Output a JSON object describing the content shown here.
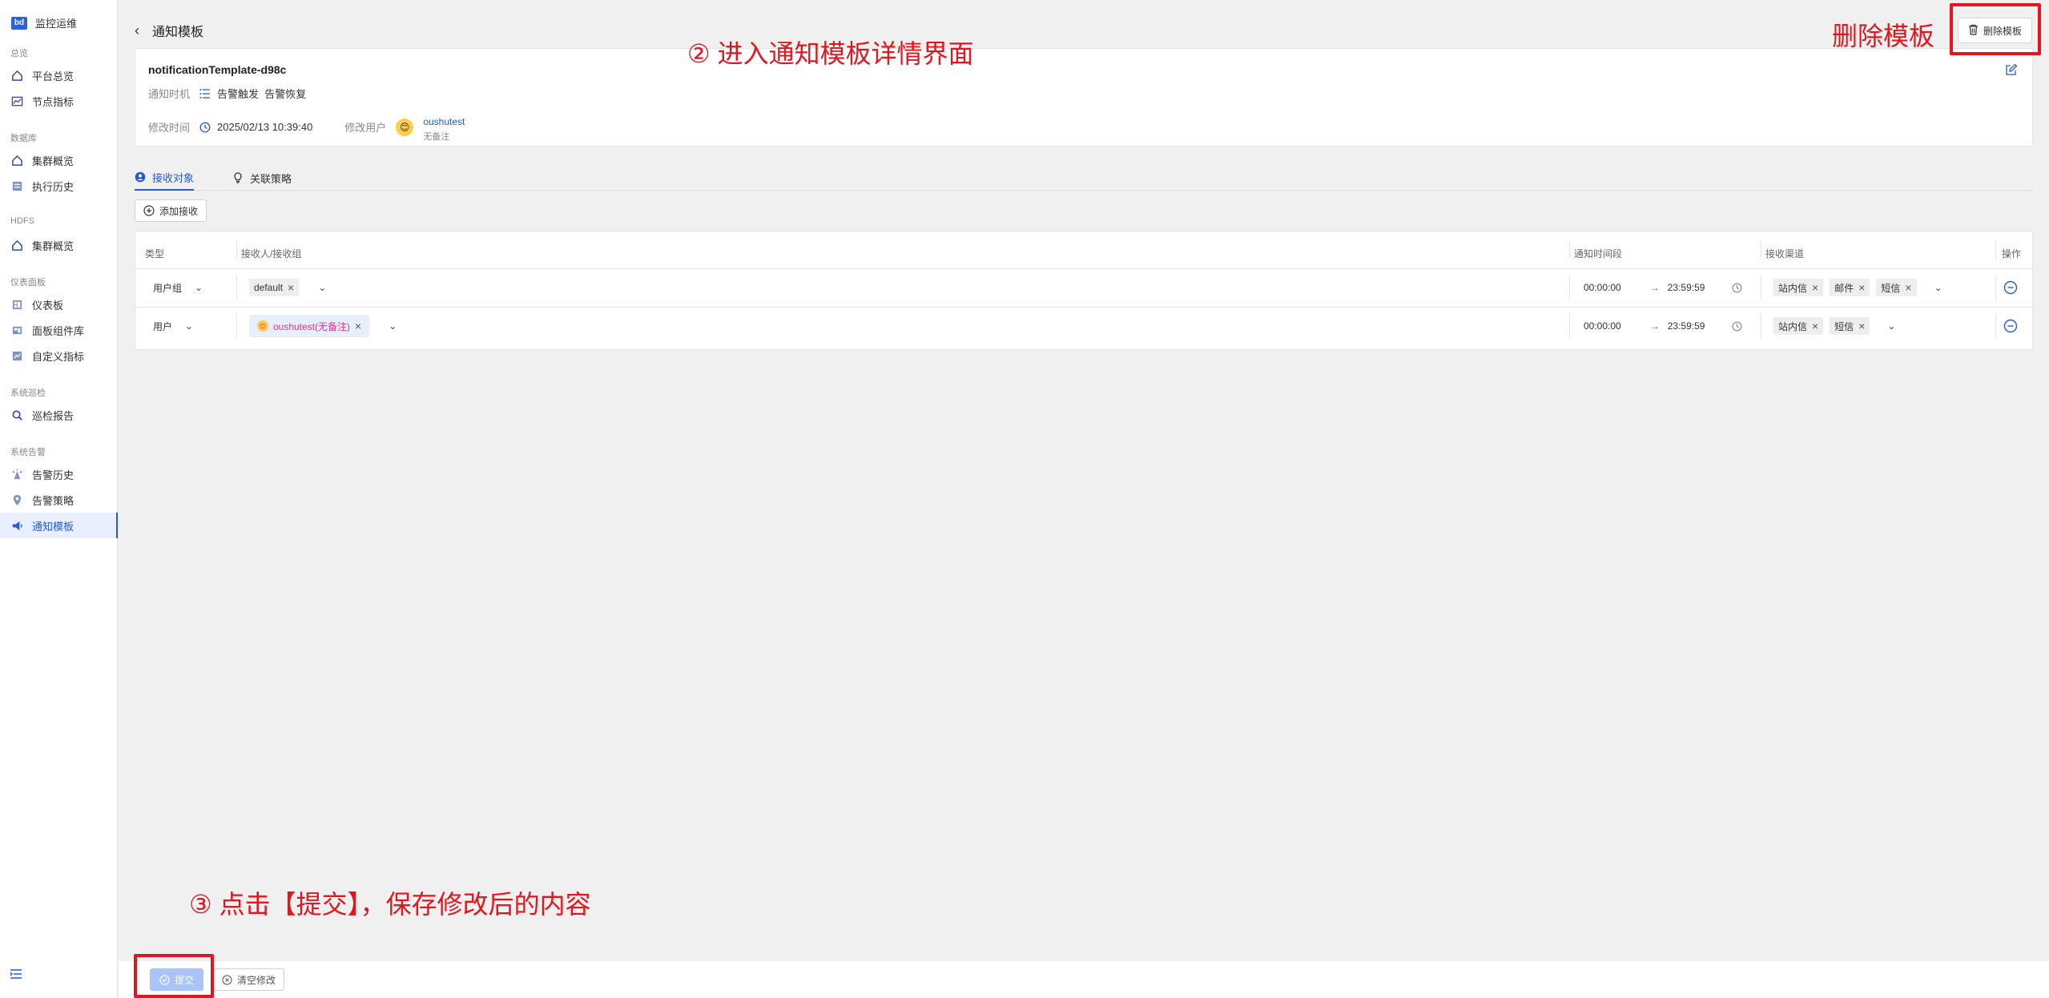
{
  "sidebar": {
    "brand": "监控运维",
    "groups": [
      {
        "title": "总览",
        "items": [
          {
            "label": "平台总览",
            "icon": "home-icon"
          },
          {
            "label": "节点指标",
            "icon": "chart-icon"
          }
        ]
      },
      {
        "title": "数据库",
        "items": [
          {
            "label": "集群概览",
            "icon": "home-icon"
          },
          {
            "label": "执行历史",
            "icon": "history-icon"
          }
        ]
      },
      {
        "title": "HDFS",
        "items": [
          {
            "label": "集群概览",
            "icon": "home-icon"
          }
        ]
      },
      {
        "title": "仪表面板",
        "items": [
          {
            "label": "仪表板",
            "icon": "dashboard-icon"
          },
          {
            "label": "面板组件库",
            "icon": "widgets-icon"
          },
          {
            "label": "自定义指标",
            "icon": "custom-metric-icon"
          }
        ]
      },
      {
        "title": "系统巡检",
        "items": [
          {
            "label": "巡检报告",
            "icon": "inspect-icon"
          }
        ]
      },
      {
        "title": "系统告警",
        "items": [
          {
            "label": "告警历史",
            "icon": "alarm-icon"
          },
          {
            "label": "告警策略",
            "icon": "strategy-icon"
          },
          {
            "label": "通知模板",
            "icon": "megaphone-icon",
            "active": true
          }
        ]
      }
    ]
  },
  "header": {
    "title": "通知模板",
    "delete_label": "删除模板"
  },
  "info": {
    "name": "notificationTemplate-d98c",
    "timing_label": "通知时机",
    "timing_values": "告警触发  告警恢复",
    "modified_time_label": "修改时间",
    "modified_time": "2025/02/13 10:39:40",
    "modified_user_label": "修改用户",
    "user_name": "oushutest",
    "user_note": "无备注"
  },
  "tabs": [
    {
      "label": "接收对象",
      "active": true
    },
    {
      "label": "关联策略",
      "active": false
    }
  ],
  "add_receiver_label": "添加接收",
  "table": {
    "headers": {
      "type": "类型",
      "receiver": "接收人/接收组",
      "period": "通知时间段",
      "channel": "接收渠道",
      "action": "操作"
    },
    "rows": [
      {
        "type": "用户组",
        "receivers": [
          "default"
        ],
        "start": "00:00:00",
        "end": "23:59:59",
        "channels": [
          "站内信",
          "邮件",
          "短信"
        ]
      },
      {
        "type": "用户",
        "receivers": [
          "oushutest(无备注)"
        ],
        "start": "00:00:00",
        "end": "23:59:59",
        "channels": [
          "站内信",
          "短信"
        ]
      }
    ]
  },
  "footer": {
    "submit_label": "提交",
    "clear_label": "清空修改"
  },
  "annotations": {
    "step2": "② 进入通知模板详情界面",
    "delete_note": "删除模板",
    "step3": "③ 点击【提交】，保存修改后的内容"
  },
  "colors": {
    "accent": "#2559d8",
    "annotation_red": "#e6141c",
    "submit_disabled": "#a9c3ff",
    "pink_text": "#d83b8a"
  }
}
